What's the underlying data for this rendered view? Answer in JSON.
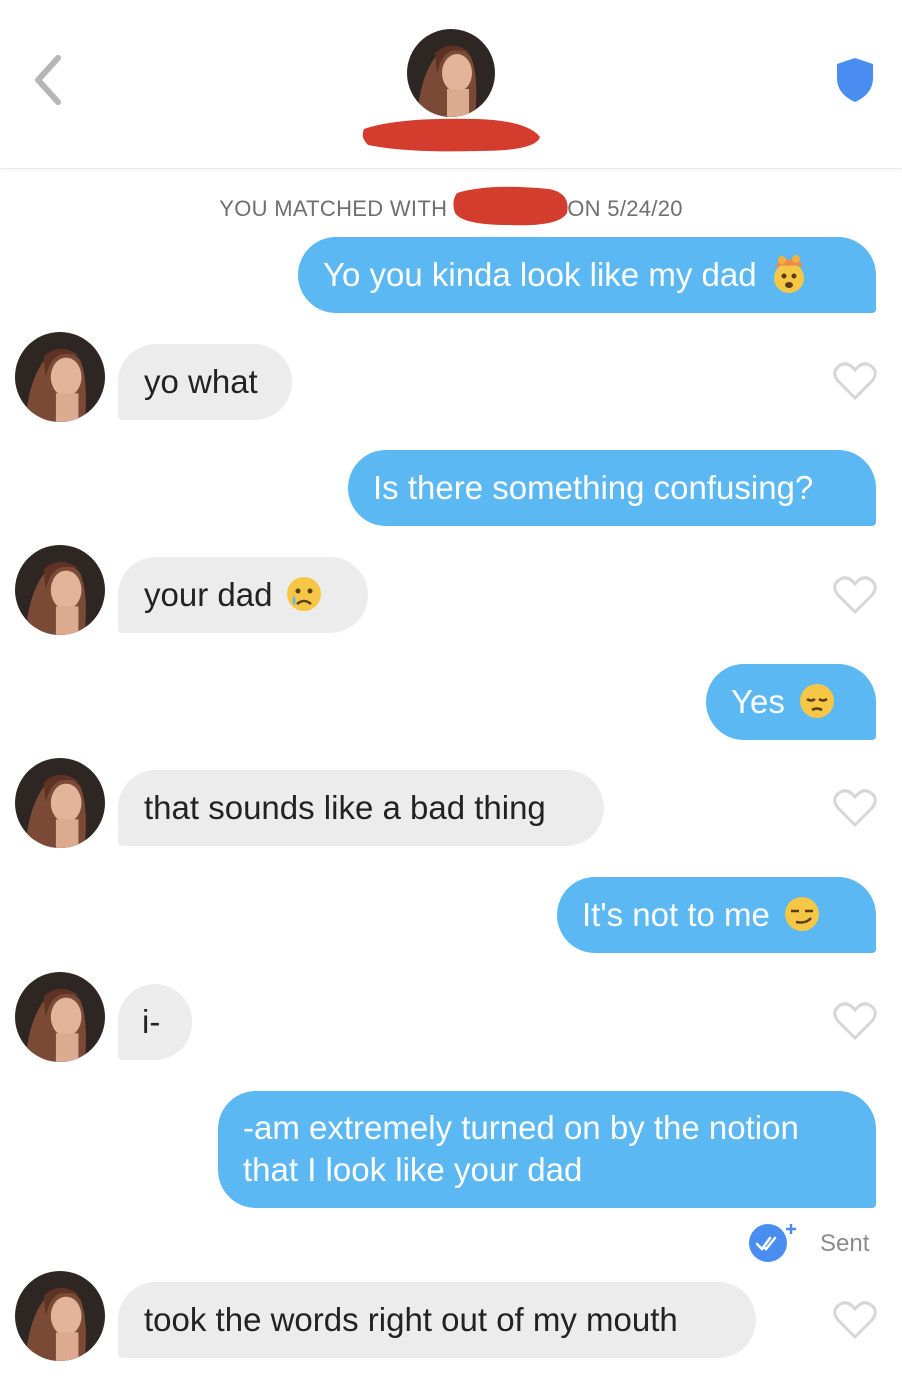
{
  "header": {
    "back_icon": "chevron-left-icon",
    "shield_icon": "shield-icon",
    "accent_color": "#4a8df0"
  },
  "match": {
    "prefix": "YOU MATCHED WITH",
    "suffix": "ON 5/24/20"
  },
  "messages": [
    {
      "from": "me",
      "text": "Yo you kinda look like my dad",
      "emoji": "exploding-head-emoji"
    },
    {
      "from": "them",
      "text": "yo what"
    },
    {
      "from": "me",
      "text": "Is there something confusing?"
    },
    {
      "from": "them",
      "text": "your dad",
      "emoji": "crying-face-emoji"
    },
    {
      "from": "me",
      "text": "Yes",
      "emoji": "pensive-face-emoji"
    },
    {
      "from": "them",
      "text": "that sounds like a bad thing"
    },
    {
      "from": "me",
      "text": "It's not to me",
      "emoji": "smirking-face-emoji"
    },
    {
      "from": "them",
      "text": "i-"
    },
    {
      "from": "me",
      "text": "-am extremely turned on by the notion that I look like your dad"
    },
    {
      "from": "them",
      "text": "took the words right out of my mouth"
    }
  ],
  "status": {
    "sent_label": "Sent",
    "icon": "double-check-icon"
  },
  "colors": {
    "outgoing_bubble": "#5bb8f2",
    "incoming_bubble": "#ececec",
    "redaction": "#d43c2e"
  }
}
